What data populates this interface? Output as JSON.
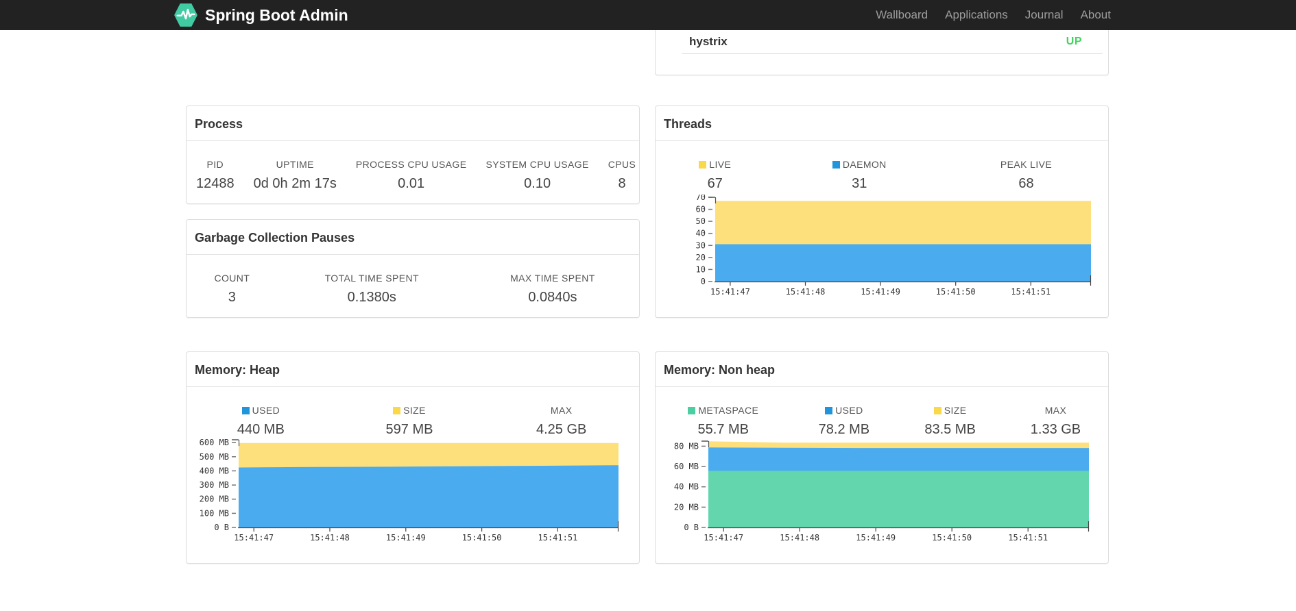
{
  "navbar": {
    "brand": "Spring Boot Admin",
    "links": [
      {
        "label": "Wallboard"
      },
      {
        "label": "Applications"
      },
      {
        "label": "Journal"
      },
      {
        "label": "About"
      }
    ]
  },
  "application_row": {
    "name": "hystrix",
    "status": "UP",
    "status_color": "#42d35f"
  },
  "cards": {
    "process": {
      "title": "Process",
      "stats": [
        {
          "label": "PID",
          "value": "12488"
        },
        {
          "label": "UPTIME",
          "value": "0d 0h 2m 17s"
        },
        {
          "label": "PROCESS CPU USAGE",
          "value": "0.01"
        },
        {
          "label": "SYSTEM CPU USAGE",
          "value": "0.10"
        },
        {
          "label": "CPUS",
          "value": "8"
        }
      ]
    },
    "gc": {
      "title": "Garbage Collection Pauses",
      "stats": [
        {
          "label": "COUNT",
          "value": "3"
        },
        {
          "label": "TOTAL TIME SPENT",
          "value": "0.1380s"
        },
        {
          "label": "MAX TIME SPENT",
          "value": "0.0840s"
        }
      ]
    },
    "threads": {
      "title": "Threads",
      "stats": [
        {
          "label": "LIVE",
          "value": "67",
          "swatch": "#f9d849"
        },
        {
          "label": "DAEMON",
          "value": "31",
          "swatch": "#2095dc"
        },
        {
          "label": "PEAK LIVE",
          "value": "68"
        }
      ]
    },
    "heap": {
      "title": "Memory: Heap",
      "stats": [
        {
          "label": "USED",
          "value": "440 MB",
          "swatch": "#2095dc"
        },
        {
          "label": "SIZE",
          "value": "597 MB",
          "swatch": "#f9d849"
        },
        {
          "label": "MAX",
          "value": "4.25 GB"
        }
      ]
    },
    "nonheap": {
      "title": "Memory: Non heap",
      "stats": [
        {
          "label": "METASPACE",
          "value": "55.7 MB",
          "swatch": "#4bcfa2"
        },
        {
          "label": "USED",
          "value": "78.2 MB",
          "swatch": "#2095dc"
        },
        {
          "label": "SIZE",
          "value": "83.5 MB",
          "swatch": "#f9d849"
        },
        {
          "label": "MAX",
          "value": "1.33 GB"
        }
      ]
    }
  },
  "chart_data": [
    {
      "id": "threads",
      "type": "area",
      "title": "Threads",
      "x": [
        "15:41:47",
        "15:41:48",
        "15:41:49",
        "15:41:50",
        "15:41:51"
      ],
      "ylim": [
        0,
        70
      ],
      "yticks": [
        {
          "v": 70,
          "label": "70"
        },
        {
          "v": 60,
          "label": "60"
        },
        {
          "v": 50,
          "label": "50"
        },
        {
          "v": 40,
          "label": "40"
        },
        {
          "v": 30,
          "label": "30"
        },
        {
          "v": 20,
          "label": "20"
        },
        {
          "v": 10,
          "label": "10"
        },
        {
          "v": 0,
          "label": "0"
        }
      ],
      "series": [
        {
          "name": "live",
          "color": "#fde07c",
          "values": [
            67,
            67,
            67,
            67,
            67,
            67
          ]
        },
        {
          "name": "daemon",
          "color": "#4aacee",
          "values": [
            31,
            31,
            31,
            31,
            31,
            31
          ]
        }
      ],
      "legend_position": "top",
      "grid": false
    },
    {
      "id": "heap",
      "type": "area",
      "title": "Memory: Heap",
      "x": [
        "15:41:47",
        "15:41:48",
        "15:41:49",
        "15:41:50",
        "15:41:51"
      ],
      "ylim": [
        0,
        620
      ],
      "yticks": [
        {
          "v": 600,
          "label": "600 MB"
        },
        {
          "v": 500,
          "label": "500 MB"
        },
        {
          "v": 400,
          "label": "400 MB"
        },
        {
          "v": 300,
          "label": "300 MB"
        },
        {
          "v": 200,
          "label": "200 MB"
        },
        {
          "v": 100,
          "label": "100 MB"
        },
        {
          "v": 0,
          "label": "0 B"
        }
      ],
      "series": [
        {
          "name": "size",
          "color": "#fde07c",
          "values": [
            597,
            597,
            597,
            597,
            597,
            597
          ]
        },
        {
          "name": "used",
          "color": "#4aacee",
          "values": [
            424,
            427,
            429,
            433,
            436,
            440
          ]
        }
      ],
      "legend_position": "top",
      "grid": false
    },
    {
      "id": "nonheap",
      "type": "area",
      "title": "Memory: Non heap",
      "x": [
        "15:41:47",
        "15:41:48",
        "15:41:49",
        "15:41:50",
        "15:41:51"
      ],
      "ylim": [
        0,
        85
      ],
      "yticks": [
        {
          "v": 80,
          "label": "80 MB"
        },
        {
          "v": 60,
          "label": "60 MB"
        },
        {
          "v": 40,
          "label": "40 MB"
        },
        {
          "v": 20,
          "label": "20 MB"
        },
        {
          "v": 0,
          "label": "0 B"
        }
      ],
      "series": [
        {
          "name": "size",
          "color": "#fde07c",
          "values": [
            84.8,
            83.5,
            83.5,
            83.5,
            83.5,
            83.5
          ]
        },
        {
          "name": "used",
          "color": "#4aacee",
          "values": [
            78.8,
            78.4,
            78.2,
            78.2,
            78.2,
            78.2
          ]
        },
        {
          "name": "metaspace",
          "color": "#63d6ae",
          "values": [
            55.7,
            55.7,
            55.7,
            55.7,
            55.7,
            55.7
          ]
        }
      ],
      "legend_position": "top",
      "grid": false
    }
  ]
}
